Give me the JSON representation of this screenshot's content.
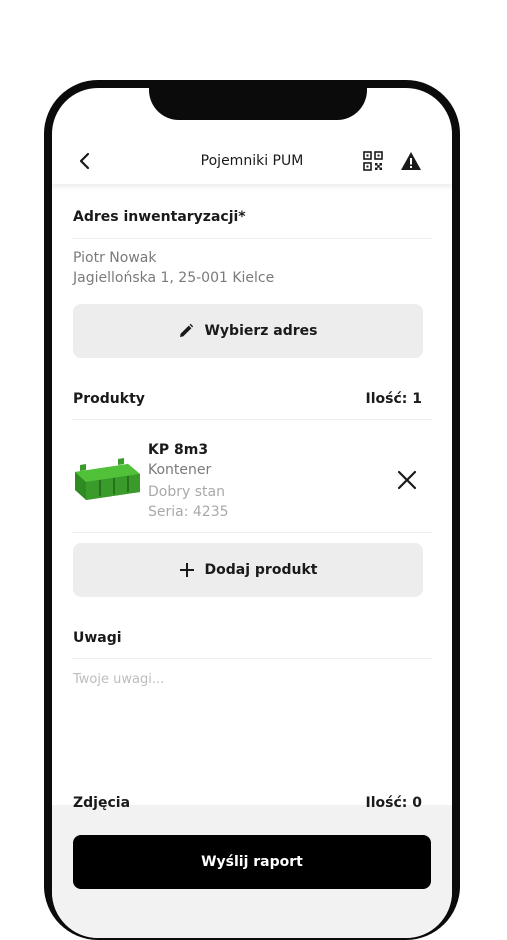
{
  "header": {
    "title": "Pojemniki PUM",
    "icons": [
      "back-chevron-icon",
      "qr-code-icon",
      "warning-icon"
    ]
  },
  "address": {
    "section_label": "Adres inwentaryzacji*",
    "name": "Piotr Nowak",
    "street": "Jagiellońska 1, 25-001 Kielce",
    "choose_button": "Wybierz adres"
  },
  "products": {
    "section_label": "Produkty",
    "count_label": "Ilość: 1",
    "items": [
      {
        "name": "KP  8m3",
        "type": "Kontener",
        "condition": "Dobry stan",
        "serial": "Seria: 4235"
      }
    ],
    "add_button": "Dodaj produkt"
  },
  "notes": {
    "section_label": "Uwagi",
    "placeholder": "Twoje uwagi..."
  },
  "photos": {
    "section_label": "Zdjęcia",
    "count_label": "Ilość: 0"
  },
  "submit_button": "Wyślij raport",
  "colors": {
    "accent": "#000000",
    "button_bg": "#ededed",
    "container_green": "#3a9a2a",
    "muted_text": "#7a7a7a"
  }
}
